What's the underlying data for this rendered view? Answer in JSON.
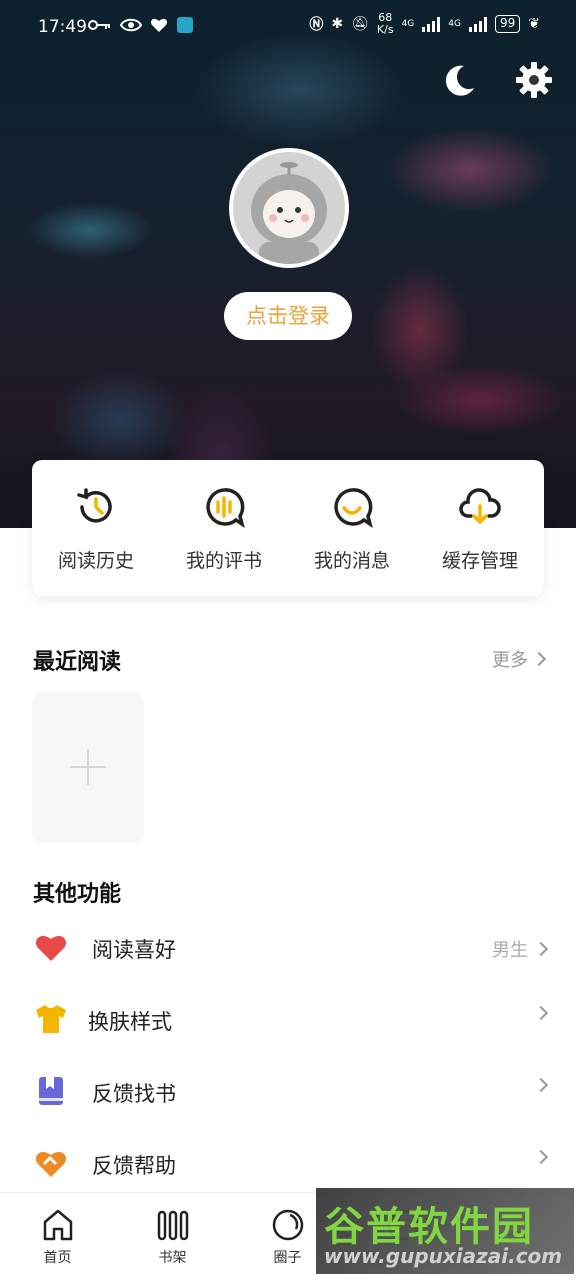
{
  "status_bar": {
    "time": "17:49",
    "net_speed_value": "68",
    "net_speed_unit": "K/s",
    "signal1_label": "4G",
    "signal2_label": "4G",
    "battery": "99"
  },
  "profile": {
    "login_label": "点击登录"
  },
  "quick_actions": [
    {
      "label": "阅读历史",
      "icon": "history-icon"
    },
    {
      "label": "我的评书",
      "icon": "audio-comment-icon"
    },
    {
      "label": "我的消息",
      "icon": "message-icon"
    },
    {
      "label": "缓存管理",
      "icon": "cloud-download-icon"
    }
  ],
  "recent": {
    "title": "最近阅读",
    "more_label": "更多"
  },
  "other": {
    "title": "其他功能",
    "items": [
      {
        "label": "阅读喜好",
        "value": "男生",
        "icon": "heart-icon"
      },
      {
        "label": "换肤样式",
        "value": "",
        "icon": "tshirt-icon"
      },
      {
        "label": "反馈找书",
        "value": "",
        "icon": "bookmark-book-icon"
      },
      {
        "label": "反馈帮助",
        "value": "",
        "icon": "help-heart-icon"
      }
    ]
  },
  "bottom_nav": [
    {
      "label": "首页",
      "icon": "home-icon"
    },
    {
      "label": "书架",
      "icon": "bookshelf-icon"
    },
    {
      "label": "圈子",
      "icon": "circle-icon"
    },
    {
      "label": "",
      "icon": "discover-icon"
    },
    {
      "label": "",
      "icon": "profile-icon"
    }
  ],
  "watermark": {
    "title": "谷普软件园",
    "url": "www.gupuxiazai.com"
  },
  "colors": {
    "accent": "#f5b400",
    "login_text": "#e8a33a",
    "heart": "#e84a4a",
    "tshirt": "#f5b400",
    "book": "#6a67d8",
    "help": "#f08a24"
  }
}
